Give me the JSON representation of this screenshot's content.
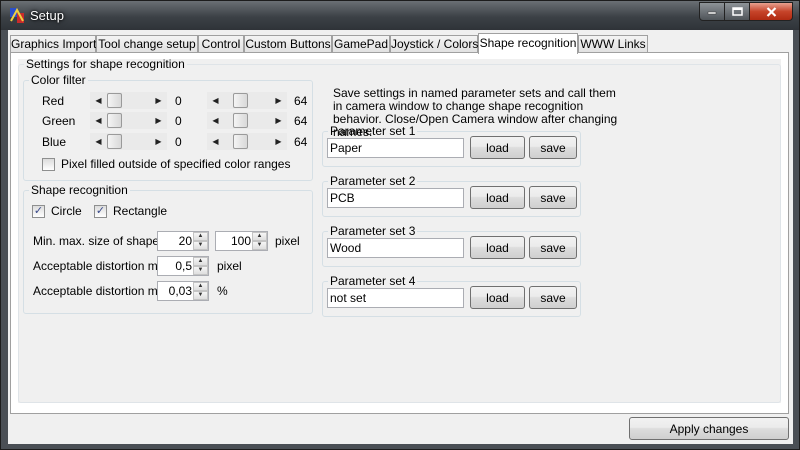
{
  "window": {
    "title": "Setup"
  },
  "tabs": [
    {
      "label": "Graphics Import",
      "active": false
    },
    {
      "label": "Tool change setup",
      "active": false
    },
    {
      "label": "Control",
      "active": false
    },
    {
      "label": "Custom Buttons",
      "active": false
    },
    {
      "label": "GamePad",
      "active": false
    },
    {
      "label": "Joystick / Colors",
      "active": false
    },
    {
      "label": "Shape recognition",
      "active": true
    },
    {
      "label": "WWW Links",
      "active": false
    }
  ],
  "settings": {
    "group_label": "Settings for shape recognition",
    "color_filter": {
      "label": "Color filter",
      "channels": [
        {
          "name": "Red",
          "min": "0",
          "max": "64"
        },
        {
          "name": "Green",
          "min": "0",
          "max": "64"
        },
        {
          "name": "Blue",
          "min": "0",
          "max": "64"
        }
      ],
      "pixel_filled_label": "Pixel filled outside of specified color ranges",
      "pixel_filled_checked": false
    },
    "shape_recognition": {
      "label": "Shape recognition",
      "circle_label": "Circle",
      "circle_checked": true,
      "rectangle_label": "Rectangle",
      "rectangle_checked": true,
      "size_label": "Min. max. size of shape",
      "size_min": "20",
      "size_max": "100",
      "size_unit": "pixel",
      "dist_min_label": "Acceptable distortion min.",
      "dist_min": "0,5",
      "dist_min_unit": "pixel",
      "dist_max_label": "Acceptable distortion max.",
      "dist_max": "0,03",
      "dist_max_unit": "%"
    },
    "description": "Save settings in named parameter sets and call them in camera window to change shape recognition behavior. Close/Open Camera window after changing names.",
    "parameter_sets": [
      {
        "label": "Parameter set 1",
        "value": "Paper",
        "load": "load",
        "save": "save"
      },
      {
        "label": "Parameter set 2",
        "value": "PCB",
        "load": "load",
        "save": "save"
      },
      {
        "label": "Parameter set 3",
        "value": "Wood",
        "load": "load",
        "save": "save"
      },
      {
        "label": "Parameter set 4",
        "value": "not set",
        "load": "load",
        "save": "save"
      }
    ]
  },
  "footer": {
    "apply_label": "Apply changes"
  },
  "icons": {
    "app": "app-icon",
    "minimize": "minimize-icon",
    "maximize": "maximize-icon",
    "close": "close-icon",
    "scroll_left": "arrow-left-icon",
    "scroll_right": "arrow-right-icon",
    "spin_up": "arrow-up-icon",
    "spin_down": "arrow-down-icon",
    "check": "checkmark-icon"
  }
}
